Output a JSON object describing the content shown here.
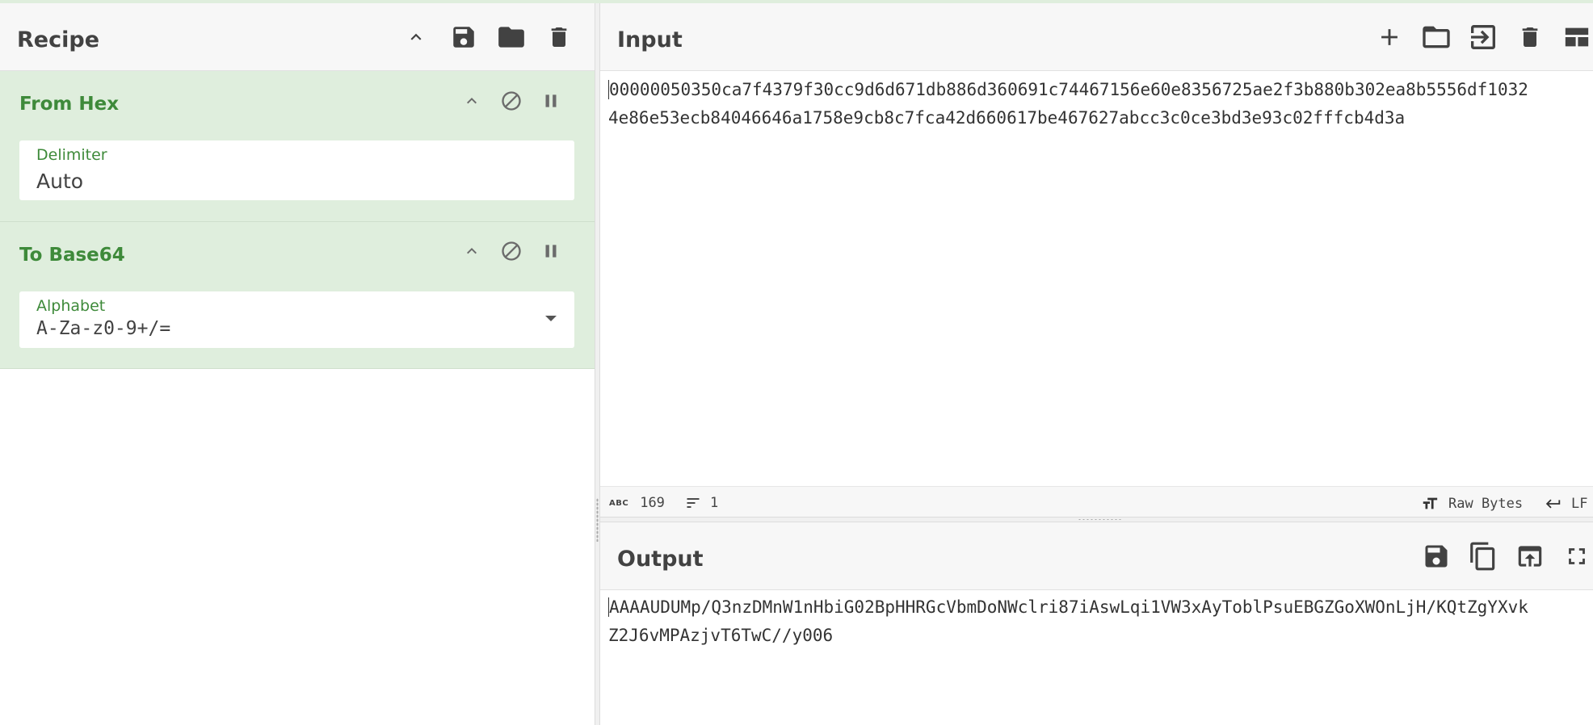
{
  "recipe": {
    "title": "Recipe",
    "icons": [
      "chevron-up-icon",
      "save-icon",
      "folder-icon",
      "trash-icon"
    ],
    "operations": [
      {
        "name": "From Hex",
        "field_label": "Delimiter",
        "field_value": "Auto"
      },
      {
        "name": "To Base64",
        "field_label": "Alphabet",
        "field_value": "A-Za-z0-9+/="
      }
    ]
  },
  "input": {
    "title": "Input",
    "icons": [
      "plus-icon",
      "folder-icon",
      "import-icon",
      "trash-icon",
      "layout-icon"
    ],
    "text_line1": "00000050350ca7f4379f30cc9d6d671db886d360691c74467156e60e8356725ae2f3b880b302ea8b5556df1032",
    "text_line2": "4e86e53ecb84046646a1758e9cb8c7fca42d660617be467627abcc3c0ce3bd3e93c02fffcb4d3a",
    "status": {
      "chars_icon": "abc-icon",
      "chars": "169",
      "lines": "1",
      "encoding": "Raw Bytes",
      "eol": "LF"
    }
  },
  "output": {
    "title": "Output",
    "icons": [
      "save-icon",
      "copy-icon",
      "replace-input-icon",
      "fullscreen-icon"
    ],
    "text_line1": "AAAAUDUMp/Q3nzDMnW1nHbiG02BpHHRGcVbmDoNWclri87iAswLqi1VW3xAyToblPsuEBGZGoXWOnLjH/KQtZgYXvk",
    "text_line2": "Z2J6vMPAzjvT6TwC//y006"
  },
  "colors": {
    "op_bg": "#dfeedd",
    "op_title": "#3e8a3a"
  }
}
